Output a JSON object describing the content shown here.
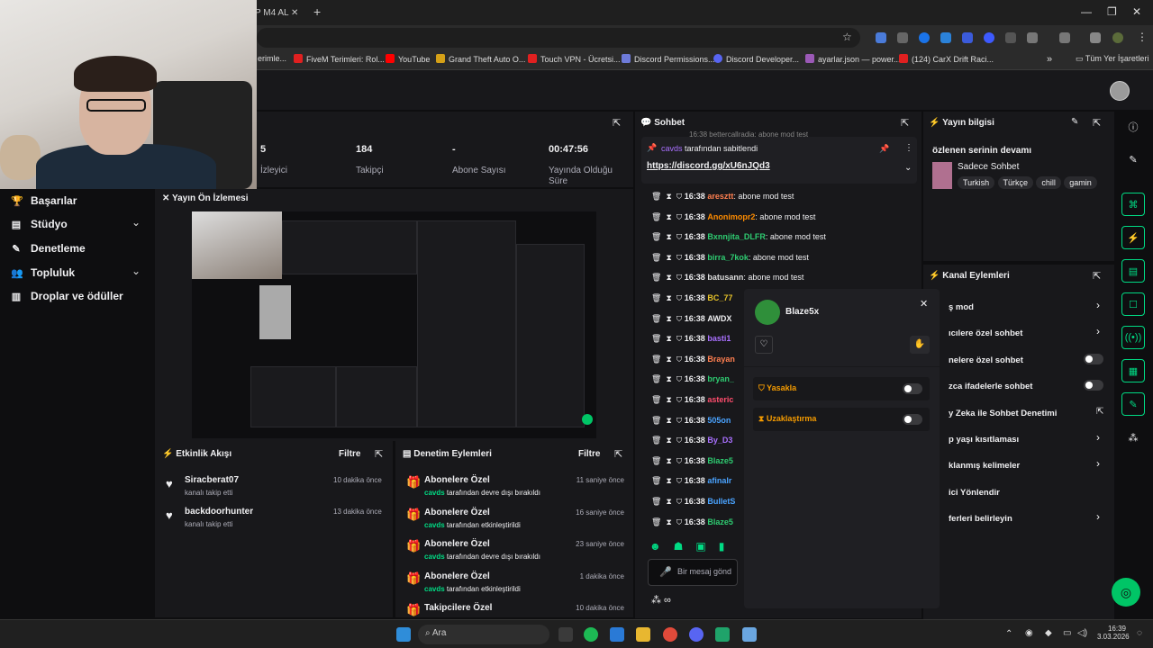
{
  "browser": {
    "tab_title": "P M4 AL",
    "new_tab": "+",
    "url": "",
    "bookmarks": [
      {
        "label": "erimle...",
        "color": "#888"
      },
      {
        "label": "FiveM Terimleri: Rol...",
        "color": "#e02020"
      },
      {
        "label": "YouTube",
        "color": "#ff0000"
      },
      {
        "label": "Grand Theft Auto O...",
        "color": "#d4a017"
      },
      {
        "label": "Touch VPN - Ücretsi...",
        "color": "#e02020"
      },
      {
        "label": "Discord Permissions...",
        "color": "#6e7bd9"
      },
      {
        "label": "Discord Developer...",
        "color": "#5865f2"
      },
      {
        "label": "ayarlar.json — power...",
        "color": "#9b59b6"
      },
      {
        "label": "(124) CarX Drift Raci...",
        "color": "#e02020"
      }
    ],
    "all_bookmarks": "Tüm Yer İşaretleri",
    "more": "»"
  },
  "sidebar": {
    "items": [
      {
        "label": "Başarılar",
        "icon": "trophy-icon",
        "glyph": "🏆"
      },
      {
        "label": "Stüdyo",
        "icon": "studio-icon",
        "glyph": "▤",
        "chevron": "⌄"
      },
      {
        "label": "Denetleme",
        "icon": "wrench-icon",
        "glyph": "✎"
      },
      {
        "label": "Topluluk",
        "icon": "people-icon",
        "glyph": "👥",
        "chevron": "⌄"
      },
      {
        "label": "Droplar ve ödüller",
        "icon": "gift-icon",
        "glyph": "▥"
      }
    ]
  },
  "stats": [
    {
      "value": "5",
      "label": "İzleyici"
    },
    {
      "value": "184",
      "label": "Takipçi"
    },
    {
      "value": "-",
      "label": "Abone Sayısı"
    },
    {
      "value": "00:47:56",
      "label": "Yayında Olduğu Süre"
    }
  ],
  "preview": {
    "title": "Yayın Ön İzlemesi"
  },
  "activity": {
    "title": "Etkinlik Akışı",
    "filter": "Filtre",
    "events": [
      {
        "user": "Siracberat07",
        "desc": "kanalı takip etti",
        "time": "10 dakika önce"
      },
      {
        "user": "backdoorhunter",
        "desc": "kanalı takip etti",
        "time": "13 dakika önce"
      }
    ]
  },
  "moderation": {
    "title": "Denetim Eylemleri",
    "filter": "Filtre",
    "events": [
      {
        "title": "Abonelere Özel",
        "who": "cavds",
        "desc": " tarafından devre dışı bırakıldı",
        "time": "11 saniye önce"
      },
      {
        "title": "Abonelere Özel",
        "who": "cavds",
        "desc": " tarafından etkinleştirildi",
        "time": "16 saniye önce"
      },
      {
        "title": "Abonelere Özel",
        "who": "cavds",
        "desc": " tarafından devre dışı bırakıldı",
        "time": "23 saniye önce"
      },
      {
        "title": "Abonelere Özel",
        "who": "cavds",
        "desc": " tarafından etkinleştirildi",
        "time": "1 dakika önce"
      },
      {
        "title": "Takipcilere Özel",
        "who": "",
        "desc": "",
        "time": "10 dakika önce"
      }
    ]
  },
  "chat": {
    "title": "Sohbet",
    "top_partial": "16:38 bettercallradia: abone mod test",
    "pinned": {
      "by": "cavds",
      "by_suffix": " tarafından sabitlendi",
      "link": "https://discord.gg/xU6nJQd3"
    },
    "messages": [
      {
        "time": "16:38",
        "user": "aresztt",
        "color": "#ff7f50",
        "text": ": abone mod test"
      },
      {
        "time": "16:38",
        "user": "Anonimopr2",
        "color": "#ff8c00",
        "text": ": abone mod test"
      },
      {
        "time": "16:38",
        "user": "Bxnnjita_DLFR",
        "color": "#2ecc71",
        "text": ": abone mod test"
      },
      {
        "time": "16:38",
        "user": "birra_7kok",
        "color": "#2ecc71",
        "text": ": abone mod test"
      },
      {
        "time": "16:38",
        "user": "batusann",
        "color": "#dddddd",
        "text": ": abone mod test"
      },
      {
        "time": "16:38",
        "user": "BC_77",
        "color": "#e6c229",
        "text": ""
      },
      {
        "time": "16:38",
        "user": "AWDX",
        "color": "#efeff1",
        "text": ""
      },
      {
        "time": "16:38",
        "user": "basti1",
        "color": "#a970ff",
        "text": ""
      },
      {
        "time": "16:38",
        "user": "Brayan",
        "color": "#ff7f50",
        "text": ""
      },
      {
        "time": "16:38",
        "user": "bryan_",
        "color": "#2ecc71",
        "text": ""
      },
      {
        "time": "16:38",
        "user": "asteric",
        "color": "#ff4d6d",
        "text": ""
      },
      {
        "time": "16:38",
        "user": "505on",
        "color": "#4aa3ff",
        "text": ""
      },
      {
        "time": "16:38",
        "user": "By_D3",
        "color": "#a970ff",
        "text": ""
      },
      {
        "time": "16:38",
        "user": "Blaze5",
        "color": "#2ecc71",
        "text": ""
      },
      {
        "time": "16:38",
        "user": "afinalr",
        "color": "#4aa3ff",
        "text": ""
      },
      {
        "time": "16:38",
        "user": "BulletS",
        "color": "#4aa3ff",
        "text": ""
      },
      {
        "time": "16:38",
        "user": "Blaze5",
        "color": "#2ecc71",
        "text": ""
      }
    ],
    "input_placeholder": "Bir mesaj gönd"
  },
  "usercard": {
    "name": "Blaze5x",
    "close": "✕",
    "ban_label": "Yasakla",
    "timeout_label": "Uzaklaştırma"
  },
  "stream_info": {
    "title": "Yayın bilgisi",
    "stream_title": "özlenen serinin devamı",
    "category": "Sadece Sohbet",
    "tags": [
      "Turkish",
      "Türkçe",
      "chill",
      "gamin"
    ]
  },
  "channel_actions": {
    "title": "Kanal Eylemleri",
    "items": [
      {
        "label": "ş mod",
        "control": "chevron"
      },
      {
        "label": "ıcılere özel sohbet",
        "control": "chevron"
      },
      {
        "label": "nelere özel sohbet",
        "control": "toggle"
      },
      {
        "label": "zca ifadelerle sohbet",
        "control": "toggle"
      },
      {
        "label": "y Zeka ile Sohbet Denetimi",
        "control": "external"
      },
      {
        "label": "p yaşı kısıtlaması",
        "control": "chevron"
      },
      {
        "label": "klanmış kelimeler",
        "control": "chevron"
      },
      {
        "label": "ici Yönlendir",
        "control": "none"
      },
      {
        "label": "ferleri belirleyin",
        "control": "chevron"
      }
    ]
  },
  "taskbar": {
    "search": "Ara",
    "time": "16:39",
    "date": "3.03.2026"
  }
}
